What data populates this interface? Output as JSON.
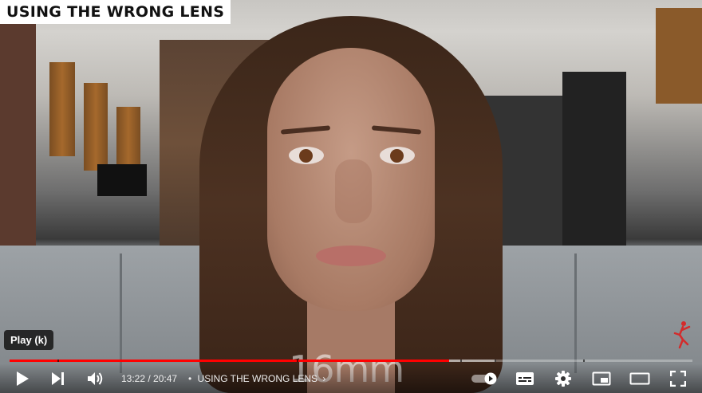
{
  "video": {
    "title_overlay": "USING THE WRONG LENS",
    "watermark": "16mm"
  },
  "tooltip": {
    "label": "Play (k)"
  },
  "progress": {
    "played_fraction": 0.644,
    "chapters": [
      0.07,
      0.42,
      0.66,
      0.71,
      0.84
    ]
  },
  "controls": {
    "time": "13:22 / 20:47",
    "chapter_sep": "•",
    "chapter_title": "USING THE WRONG LENS",
    "chapter_chevron": "›"
  },
  "icons": {
    "play": "play-icon",
    "next": "next-icon",
    "volume": "volume-icon",
    "autoplay": "autoplay-toggle",
    "subtitles": "subtitles-icon",
    "settings": "gear-icon",
    "miniplayer": "miniplayer-icon",
    "theater": "theater-icon",
    "fullscreen": "fullscreen-icon"
  },
  "colors": {
    "accent": "#ff0000",
    "logo": "#d42b2b"
  }
}
